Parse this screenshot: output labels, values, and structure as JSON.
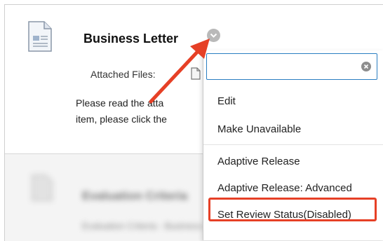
{
  "item": {
    "title": "Business Letter",
    "attached_label": "Attached Files:",
    "description_line1": "Please read the atta",
    "description_line2": "item, please click the"
  },
  "blurred_item": {
    "title": "Evaluation Criteria",
    "subtitle": "Evaluation Criteria - Business Letter"
  },
  "menu": {
    "search_value": "",
    "items": [
      "Edit",
      "Make Unavailable",
      "Adaptive Release",
      "Adaptive Release: Advanced",
      "Set Review Status(Disabled)"
    ],
    "highlighted_item": "Set Review Status(Disabled)"
  },
  "colors": {
    "accent_blue": "#2a7ec1",
    "annotation_red": "#e64026"
  },
  "icons": [
    "document-icon",
    "chevron-down-icon",
    "attachment-icon",
    "clear-icon",
    "annotation-arrow-icon"
  ]
}
